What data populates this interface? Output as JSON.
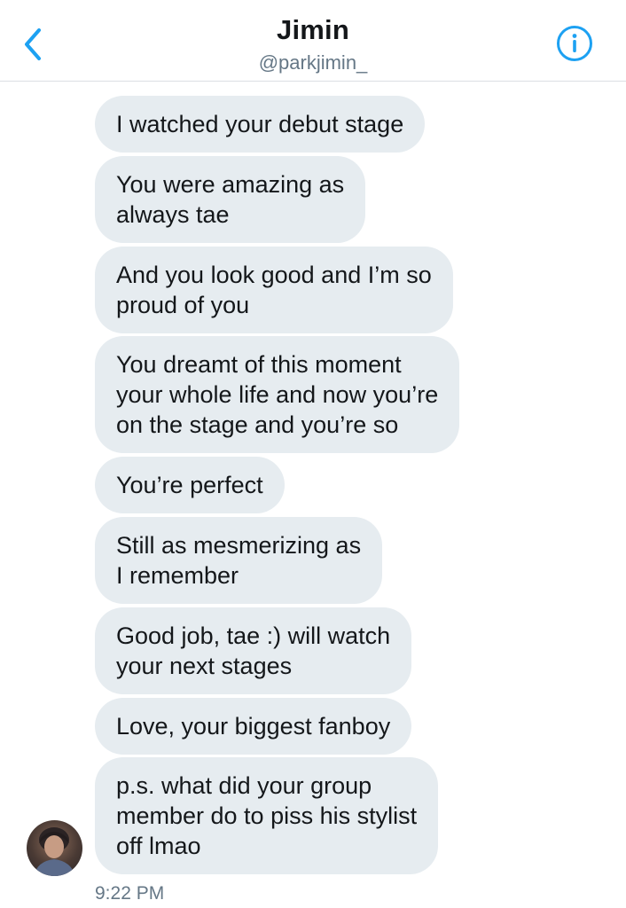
{
  "header": {
    "title": "Jimin",
    "handle": "@parkjimin_"
  },
  "messages": [
    "I watched your debut stage",
    "You were amazing as\nalways tae",
    "And you look good and I’m so\nproud of you",
    "You dreamt of this moment\nyour whole life and now you’re\non the stage and you’re so",
    "You’re perfect",
    "Still as mesmerizing as\nI remember",
    "Good job, tae :) will watch\nyour next stages",
    "Love, your biggest fanboy",
    "p.s. what did your group\nmember do to piss his stylist\noff lmao"
  ],
  "timestamp": "9:22 PM",
  "colors": {
    "accent": "#1da1f2",
    "bubble": "#e6ecf0",
    "text": "#14171a",
    "muted": "#657786"
  },
  "icons": {
    "back": "chevron-left-icon",
    "info": "info-icon"
  }
}
